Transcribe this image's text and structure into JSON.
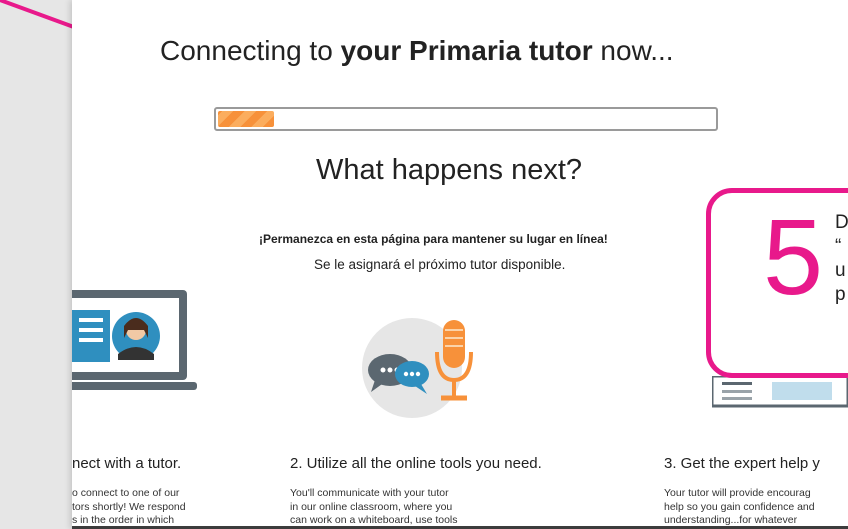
{
  "header": {
    "title_prefix": "Connecting to ",
    "title_bold": "your Primaria tutor",
    "title_suffix": " now..."
  },
  "progress": {
    "fraction": 0.12,
    "color": "#f7913a"
  },
  "next": {
    "heading": "What happens next?",
    "stay_message": "¡Permanezca en esta página para mantener su lugar en línea!",
    "assign_message": "Se le asignará el próximo tutor disponible."
  },
  "steps": [
    {
      "title": "nect with a tutor.",
      "lines": [
        "o connect to one of our",
        "tors shortly! We respond",
        "s in the order in which"
      ]
    },
    {
      "title": "2. Utilize all the online tools you need.",
      "lines": [
        "You'll communicate with your tutor",
        "in our online classroom, where you",
        "can work on a whiteboard, use tools"
      ]
    },
    {
      "title": "3. Get the expert help y",
      "lines": [
        "Your tutor will provide encourag",
        "help so you gain confidence and",
        "understanding...for whatever"
      ]
    }
  ],
  "callout": {
    "number": "5",
    "lines": [
      "D",
      "“",
      "u",
      "p"
    ],
    "border_color": "#e8198b"
  },
  "icons": [
    "pointer-arrow-icon",
    "laptop-tutor-icon",
    "chat-bubbles-icon",
    "microphone-icon",
    "document-icon"
  ],
  "colors": {
    "accent_pink": "#e8198b",
    "progress_orange": "#f7913a",
    "icon_blue": "#2f8fbf",
    "icon_gray": "#5b6770"
  }
}
